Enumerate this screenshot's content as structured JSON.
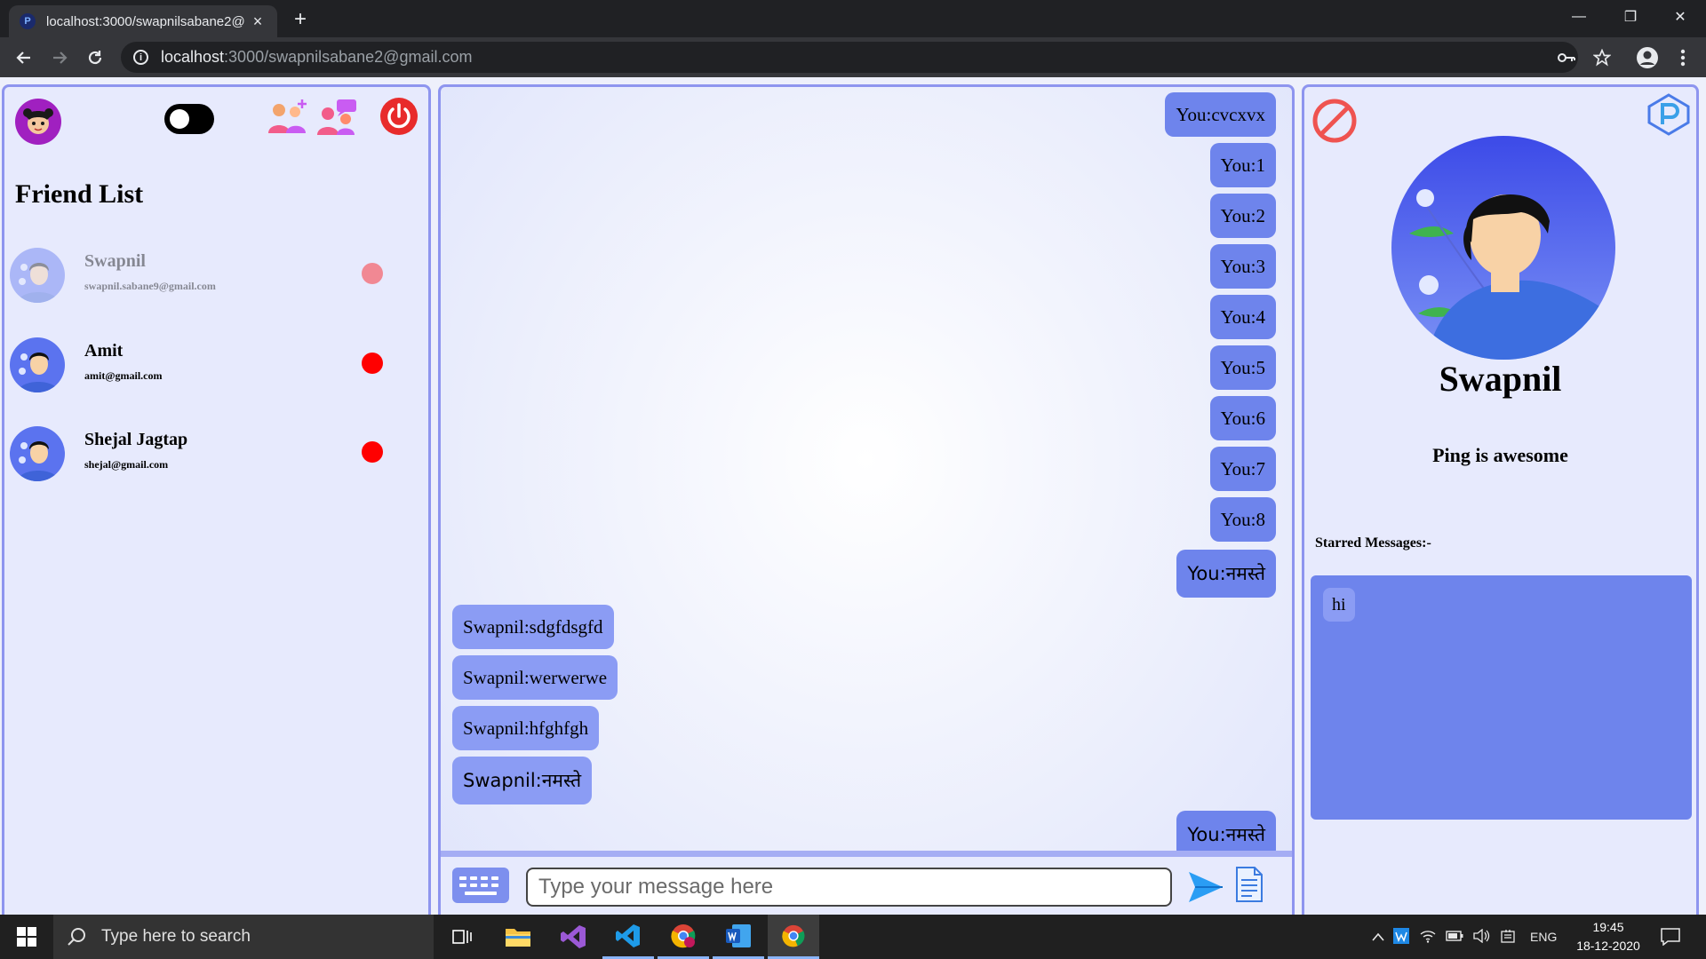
{
  "browser": {
    "tab_title": "localhost:3000/swapnilsabane2@",
    "tab_close": "×",
    "new_tab": "+",
    "url_host": "localhost",
    "url_path": ":3000/swapnilsabane2@gmail.com"
  },
  "window_controls": {
    "minimize": "—",
    "restore": "❐",
    "close": "✕"
  },
  "sidebar": {
    "title": "Friend List",
    "friends": [
      {
        "name": "Swapnil",
        "email": "swapnil.sabane9@gmail.com",
        "status_color": "#ff0000",
        "selected": true
      },
      {
        "name": "Amit",
        "email": "amit@gmail.com",
        "status_color": "#ff0000",
        "selected": false
      },
      {
        "name": "Shejal Jagtap",
        "email": "shejal@gmail.com",
        "status_color": "#ff0000",
        "selected": false
      }
    ]
  },
  "chat": {
    "messages": [
      {
        "text": "You:cvcxvx",
        "from": "me"
      },
      {
        "text": "You:1",
        "from": "me"
      },
      {
        "text": "You:2",
        "from": "me"
      },
      {
        "text": "You:3",
        "from": "me"
      },
      {
        "text": "You:4",
        "from": "me"
      },
      {
        "text": "You:5",
        "from": "me"
      },
      {
        "text": "You:6",
        "from": "me"
      },
      {
        "text": "You:7",
        "from": "me"
      },
      {
        "text": "You:8",
        "from": "me"
      },
      {
        "text": "You:नमस्ते",
        "from": "me"
      },
      {
        "text": "Swapnil:sdgfdsgfd",
        "from": "them"
      },
      {
        "text": "Swapnil:werwerwe",
        "from": "them"
      },
      {
        "text": "Swapnil:hfghfgh",
        "from": "them"
      },
      {
        "text": "Swapnil:नमस्ते",
        "from": "them"
      },
      {
        "text": "You:नमस्ते",
        "from": "me"
      }
    ],
    "input_placeholder": "Type your message here"
  },
  "profile": {
    "name": "Swapnil",
    "status": "Ping is awesome",
    "starred_label": "Starred Messages:-",
    "starred": [
      "hi"
    ]
  },
  "taskbar": {
    "search_placeholder": "Type here to search",
    "language": "ENG",
    "time": "19:45",
    "date": "18-12-2020"
  },
  "colors": {
    "accent": "#6e84ec",
    "bubble_theirs": "#8b9cf4",
    "panel_border": "#8e95ef",
    "status_offline": "#ff0000",
    "power_red": "#e82b2b"
  }
}
